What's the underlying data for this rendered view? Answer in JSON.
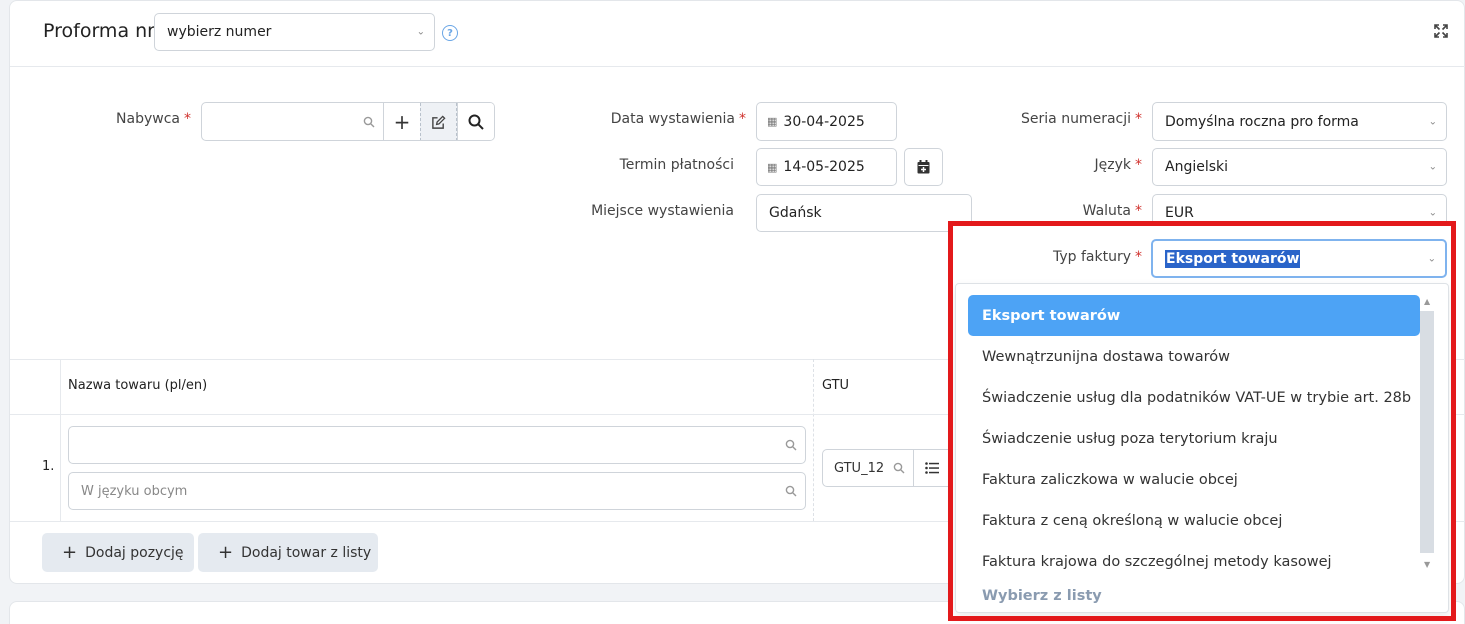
{
  "header": {
    "title": "Proforma nr",
    "number_select": "wybierz numer"
  },
  "buyer": {
    "label": "Nabywca",
    "value": ""
  },
  "dates": {
    "issue_label": "Data wystawienia",
    "issue_value": "30-04-2025",
    "due_label": "Termin płatności",
    "due_value": "14-05-2025",
    "place_label": "Miejsce wystawienia",
    "place_value": "Gdańsk"
  },
  "settings": {
    "series_label": "Seria numeracji",
    "series_value": "Domyślna roczna pro forma",
    "language_label": "Język",
    "language_value": "Angielski",
    "currency_label": "Waluta",
    "currency_value": "EUR",
    "type_label": "Typ faktury",
    "type_value": "Eksport towarów"
  },
  "table": {
    "col_name": "Nazwa towaru (pl/en)",
    "col_gtu": "GTU",
    "row_index": "1.",
    "foreign_placeholder": "W języku obcym",
    "gtu_value": "GTU_12"
  },
  "buttons": {
    "add_position": "Dodaj pozycję",
    "add_from_list": "Dodaj towar z listy"
  },
  "dropdown": {
    "options": [
      "Eksport towarów",
      "Wewnątrzunijna dostawa towarów",
      "Świadczenie usług dla podatników VAT-UE w trybie art. 28b",
      "Świadczenie usług poza terytorium kraju",
      "Faktura zaliczkowa w walucie obcej",
      "Faktura z ceną określoną w walucie obcej",
      "Faktura krajowa do szczególnej metody kasowej"
    ],
    "placeholder": "Wybierz z listy"
  },
  "colors": {
    "accent": "#4da3f5",
    "highlight": "#e3191b",
    "required": "#d0312d"
  }
}
